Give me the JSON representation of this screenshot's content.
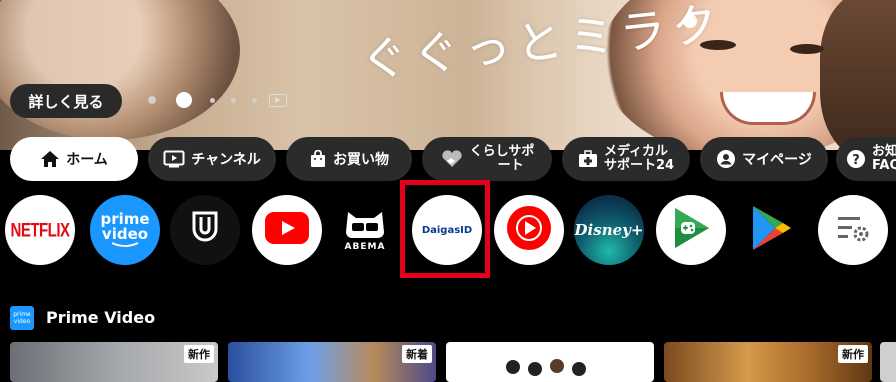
{
  "hero": {
    "slogan": "ぐぐっとミラク",
    "details_button": "詳しく見る",
    "carousel_count": 6,
    "carousel_active_index": 1
  },
  "categories": [
    {
      "label": "ホーム",
      "icon": "home-icon",
      "selected": true
    },
    {
      "label": "チャンネル",
      "icon": "tv-icon"
    },
    {
      "label": "お買い物",
      "icon": "shopping-bag-icon"
    },
    {
      "label_line1": "くらしサポ",
      "label_line2": "ート",
      "icon": "handshake-heart-icon"
    },
    {
      "label_line1": "メディカル",
      "label_line2": "サポート24",
      "icon": "medical-kit-icon"
    },
    {
      "label": "マイページ",
      "icon": "account-icon"
    },
    {
      "label_line1": "お知",
      "label_line2": "FAQ",
      "icon": "help-icon"
    }
  ],
  "apps": [
    {
      "name": "NETFLIX",
      "icon": "netflix-icon"
    },
    {
      "label_line1": "prime",
      "label_line2": "video",
      "icon": "prime-video-icon"
    },
    {
      "name": "U-NEXT",
      "icon": "unext-icon"
    },
    {
      "name": "YouTube",
      "icon": "youtube-icon"
    },
    {
      "name": "ABEMA",
      "icon": "abema-icon"
    },
    {
      "name": "DaigasID",
      "icon": "daigas-id-icon",
      "highlighted": true
    },
    {
      "name": "YouTube Music",
      "icon": "youtube-music-icon"
    },
    {
      "name": "Disney+",
      "icon": "disney-plus-icon"
    },
    {
      "name": "Google Play Games",
      "icon": "play-games-icon"
    },
    {
      "name": "Google Play Store",
      "icon": "play-store-icon"
    },
    {
      "name": "Settings",
      "icon": "app-settings-icon"
    }
  ],
  "section": {
    "badge_line1": "prime",
    "badge_line2": "video",
    "title": "Prime Video",
    "thumbnails": [
      {
        "tag": "新作"
      },
      {
        "tag": "新着"
      },
      {
        "tag": ""
      },
      {
        "tag": "新作"
      }
    ]
  },
  "colors": {
    "highlight": "#e4001c",
    "chip_bg": "#2b2b2b",
    "netflix_red": "#e50914",
    "prime_blue": "#1a98ff"
  }
}
